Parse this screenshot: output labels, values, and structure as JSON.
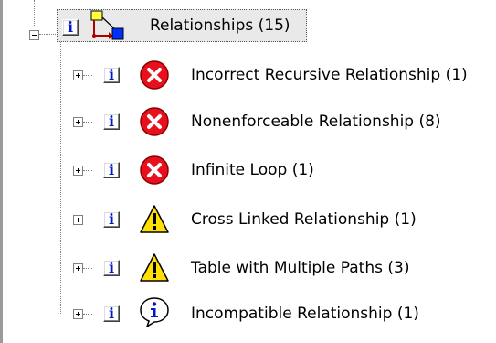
{
  "tree": {
    "root": {
      "label": "Relationships (15)",
      "icon": "relationship-diagram-icon",
      "info_glyph": "i",
      "expanded": true
    },
    "items": [
      {
        "label": "Incorrect Recursive Relationship (1)",
        "severity": "error",
        "icon": "error-icon",
        "info_glyph": "i"
      },
      {
        "label": "Nonenforceable Relationship (8)",
        "severity": "error",
        "icon": "error-icon",
        "info_glyph": "i"
      },
      {
        "label": "Infinite Loop (1)",
        "severity": "error",
        "icon": "error-icon",
        "info_glyph": "i"
      },
      {
        "label": "Cross Linked Relationship (1)",
        "severity": "warning",
        "icon": "warning-icon",
        "info_glyph": "i"
      },
      {
        "label": "Table with Multiple Paths (3)",
        "severity": "warning",
        "icon": "warning-icon",
        "info_glyph": "i"
      },
      {
        "label": "Incompatible Relationship (1)",
        "severity": "info",
        "icon": "info-balloon-icon",
        "info_glyph": "i"
      }
    ]
  },
  "colors": {
    "error": "#e8101c",
    "warning": "#ffe000",
    "info_glyph": "#0018c8",
    "selection_bg": "#e9e9e9"
  }
}
